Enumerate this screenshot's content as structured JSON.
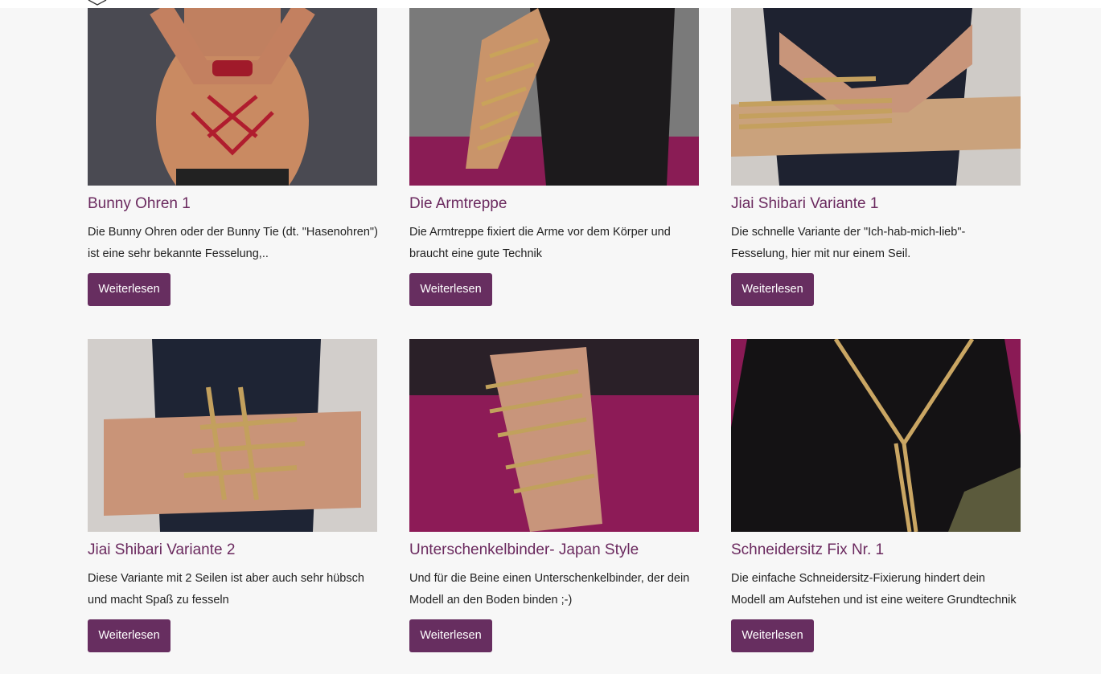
{
  "cards": [
    {
      "title": "Bunny Ohren 1",
      "excerpt": "Die Bunny Ohren oder der Bunny Tie (dt. \"Hasenohren\") ist eine sehr bekannte Fesselung,..",
      "button": "Weiterlesen",
      "image": "red-rope-back-tie-photo"
    },
    {
      "title": "Die Armtreppe",
      "excerpt": "Die Armtreppe fixiert die Arme vor dem Körper und braucht eine gute Technik",
      "button": "Weiterlesen",
      "image": "arm-ladder-rope-photo"
    },
    {
      "title": "Jiai Shibari Variante 1",
      "excerpt": "Die schnelle Variante der \"Ich-hab-mich-lieb\"-Fesselung, hier mit nur einem Seil.",
      "button": "Weiterlesen",
      "image": "self-hug-rope-photo"
    },
    {
      "title": "Jiai Shibari Variante 2",
      "excerpt": "Diese Variante mit 2 Seilen ist aber auch sehr hübsch und macht Spaß zu fesseln",
      "button": "Weiterlesen",
      "image": "self-hug-two-ropes-photo"
    },
    {
      "title": "Unterschenkelbinder- Japan Style",
      "excerpt": "Und für die Beine einen Unterschenkelbinder, der dein Modell an den Boden binden ;-)",
      "button": "Weiterlesen",
      "image": "leg-binder-rope-photo"
    },
    {
      "title": "Schneidersitz Fix Nr. 1",
      "excerpt": "Die einfache Schneidersitz-Fixierung hindert dein Modell am Aufstehen und ist eine weitere Grundtechnik",
      "button": "Weiterlesen",
      "image": "cross-legged-tie-photo"
    }
  ],
  "colors": {
    "accent": "#672e60",
    "title": "#6b2a5f",
    "background": "#f7f7f7"
  }
}
